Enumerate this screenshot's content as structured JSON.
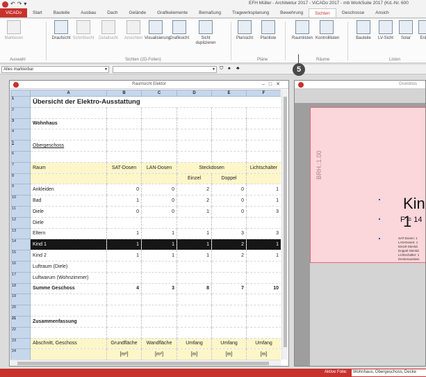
{
  "app": {
    "window_title": "EFH Müller - Architektur 2017 - ViCADo 2017 - mb WorkSuite 2017 (Kd.-Nr. 600",
    "quick_access": [
      "↶",
      "↷",
      "▾"
    ]
  },
  "tabs": [
    "ViCADo",
    "Start",
    "Bauteile",
    "Ausbau",
    "Dach",
    "Gelände",
    "Grafikelemente",
    "Bemaßung",
    "Tragwerksplanung",
    "Bewehrung",
    "Sichten",
    "Geschosse",
    "Ansich"
  ],
  "active_tab": "Sichten",
  "ribbon": {
    "buttons": [
      {
        "label": "Markieren",
        "dim": true
      },
      {
        "label": "Draufsicht",
        "dim": false
      },
      {
        "label": "Schnittsicht",
        "dim": true
      },
      {
        "label": "Detailsicht",
        "dim": true
      },
      {
        "label": "Ansichten",
        "dim": true
      },
      {
        "label": "Visualisierung",
        "dim": false
      },
      {
        "label": "Grafiksicht",
        "dim": false
      },
      {
        "label": "Sicht duplizieren",
        "dim": false
      },
      {
        "label": "Plansicht",
        "dim": false
      },
      {
        "label": "Planliste",
        "dim": false
      },
      {
        "label": "Raumlisten",
        "dim": false
      },
      {
        "label": "Kontrolllisten",
        "dim": false
      },
      {
        "label": "Bauteile",
        "dim": false
      },
      {
        "label": "LV-Sicht",
        "dim": false
      },
      {
        "label": "Solar",
        "dim": false
      },
      {
        "label": "EnEV",
        "dim": false
      }
    ],
    "groups": [
      "Auswahl",
      "Sichten (2D-Folien)",
      "Pläne",
      "Räume",
      "Listen"
    ]
  },
  "filter": {
    "value": "Alles markierbar"
  },
  "badge": "5",
  "sheet": {
    "title": "Raumsicht Elektor",
    "columns": [
      "A",
      "B",
      "C",
      "D",
      "E",
      "F"
    ],
    "rows": [
      {
        "n": "1",
        "cells": [
          "Übersicht der Elektro-Ausstattung",
          "",
          "",
          "",
          "",
          ""
        ],
        "style": "big"
      },
      {
        "n": "2",
        "cells": [
          "",
          "",
          "",
          "",
          "",
          ""
        ]
      },
      {
        "n": "3",
        "cells": [
          "Wohnhaus",
          "",
          "",
          "",
          "",
          ""
        ],
        "style": "subhead"
      },
      {
        "n": "4",
        "cells": [
          "",
          "",
          "",
          "",
          "",
          ""
        ]
      },
      {
        "n": "5",
        "cells": [
          "Obergeschoss",
          "",
          "",
          "",
          "",
          ""
        ],
        "style": "uline"
      },
      {
        "n": "6",
        "cells": [
          "",
          "",
          "",
          "",
          "",
          ""
        ]
      },
      {
        "n": "7",
        "cells": [
          "Raum",
          "SAT-Dosen",
          "LAN-Dosen",
          "Steckdosen",
          "",
          "Lichtschalter"
        ],
        "style": "yel"
      },
      {
        "n": "8",
        "cells": [
          "",
          "",
          "",
          "Einzel",
          "Doppel",
          ""
        ],
        "style": "yel"
      },
      {
        "n": "9",
        "cells": [
          "Ankleiden",
          "0",
          "0",
          "2",
          "0",
          "1"
        ]
      },
      {
        "n": "10",
        "cells": [
          "Bad",
          "1",
          "0",
          "2",
          "0",
          "1"
        ]
      },
      {
        "n": "11",
        "cells": [
          "Diele",
          "0",
          "0",
          "1",
          "0",
          "3"
        ]
      },
      {
        "n": "12",
        "cells": [
          "Diele",
          "",
          "",
          "",
          "",
          ""
        ]
      },
      {
        "n": "13",
        "cells": [
          "Eltern",
          "1",
          "1",
          "1",
          "3",
          "3"
        ]
      },
      {
        "n": "14",
        "cells": [
          "Kind 1",
          "1",
          "1",
          "1",
          "2",
          "1"
        ],
        "style": "sel"
      },
      {
        "n": "15",
        "cells": [
          "Kind 2",
          "1",
          "1",
          "1",
          "2",
          "1"
        ]
      },
      {
        "n": "16",
        "cells": [
          "Luftraum (Diele)",
          "",
          "",
          "",
          "",
          ""
        ]
      },
      {
        "n": "17",
        "cells": [
          "Luftwarum (Wohnzimmer)",
          "",
          "",
          "",
          "",
          ""
        ]
      },
      {
        "n": "18",
        "cells": [
          "Summe Geschoss",
          "4",
          "3",
          "8",
          "7",
          "10"
        ],
        "style": "bold"
      },
      {
        "n": "19",
        "cells": [
          "",
          "",
          "",
          "",
          "",
          ""
        ]
      },
      {
        "n": "20",
        "cells": [
          "",
          "",
          "",
          "",
          "",
          ""
        ]
      },
      {
        "n": "21",
        "cells": [
          "Zusammenfassung",
          "",
          "",
          "",
          "",
          ""
        ],
        "style": "subhead"
      },
      {
        "n": "22",
        "cells": [
          "",
          "",
          "",
          "",
          "",
          ""
        ]
      },
      {
        "n": "23",
        "cells": [
          "Abschnitt, Geschoss",
          "Grundfläche",
          "Wandfläche",
          "Umfang",
          "Umfang",
          "Umfang"
        ],
        "style": "yel"
      },
      {
        "n": "24",
        "cells": [
          "",
          "[m²]",
          "[m²]",
          "[m]",
          "[m]",
          "[m]"
        ],
        "style": "yel"
      }
    ]
  },
  "plan": {
    "title": "Grundriss",
    "brh": "BRH.:1.00",
    "room_name": "Kind 1",
    "room_area": "F = 14",
    "lines": [
      "SAT-Dosen: 1",
      "LAN-Dosen: 1",
      "Einzel-Steckd.",
      "Doppel-Steckd.",
      "Lichtschalter: 1",
      "Deckenauslass"
    ]
  },
  "status": {
    "label": "Aktive Folie:",
    "value": "Wohnhaus, Obergeschoss, Decke"
  },
  "colors": {
    "brand": "#c8322d",
    "header_blue": "#c6d7ec",
    "row_yellow": "#fdf6c8",
    "room_pink": "#fbd6da"
  }
}
